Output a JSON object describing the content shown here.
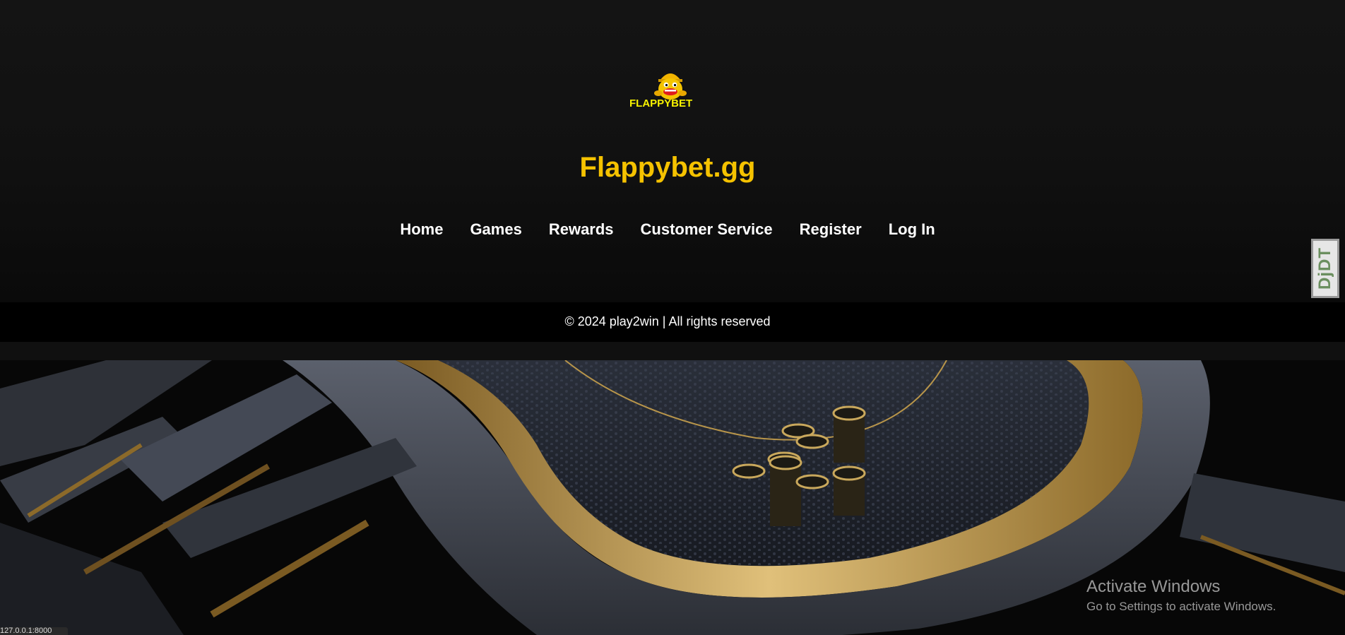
{
  "logo": {
    "wordmark": "FLAPPYBET",
    "icon": "flappy-bird-mascot-icon"
  },
  "site_title": "Flappybet.gg",
  "nav": {
    "items": [
      "Home",
      "Games",
      "Rewards",
      "Customer Service",
      "Register",
      "Log In"
    ]
  },
  "footer": {
    "copyright": "© 2024 play2win | All rights reserved"
  },
  "hero": {
    "image": "poker-table-chips-image"
  },
  "debug_toolbar": {
    "label": "DjDT"
  },
  "windows_watermark": {
    "title": "Activate Windows",
    "subtitle": "Go to Settings to activate Windows."
  },
  "status_url": "127.0.0.1:8000",
  "colors": {
    "accent": "#f5c200",
    "background": "#0c0c0c",
    "footer": "#000000",
    "text": "#ffffff"
  }
}
